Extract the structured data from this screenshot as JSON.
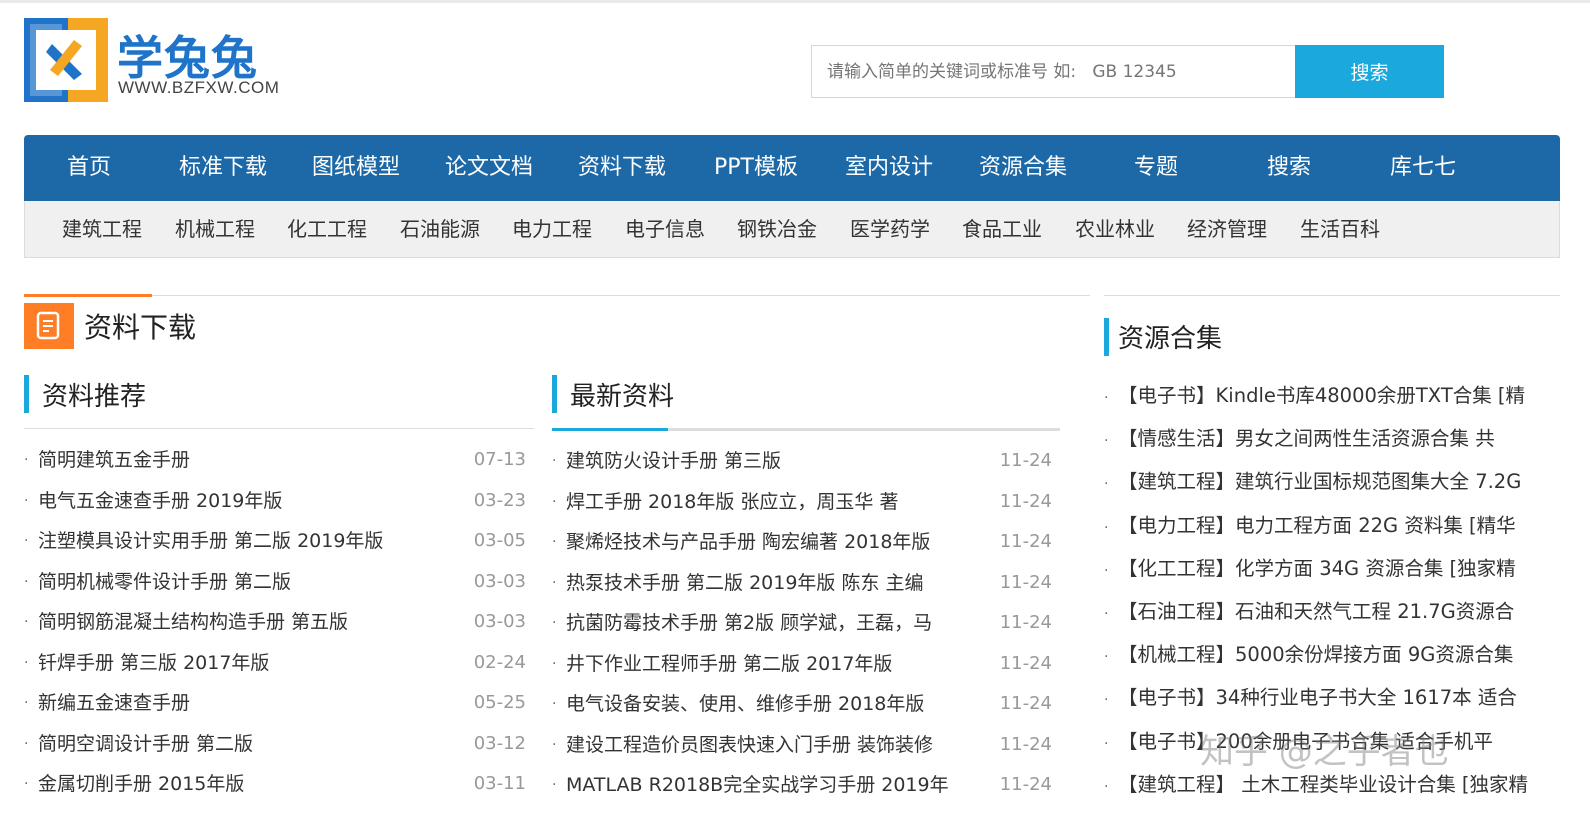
{
  "logo": {
    "brand_text": "学兔兔",
    "url_text": "WWW.BZFXW.COM",
    "colors": {
      "blue": "#1f74c9",
      "orange": "#f5a623"
    }
  },
  "search": {
    "placeholder": "请输入简单的关键词或标准号 如:   GB 12345",
    "button_label": "搜索",
    "button_color": "#1aa8dd"
  },
  "main_nav": {
    "color": "#1d69a8",
    "items": [
      "首页",
      "标准下载",
      "图纸模型",
      "论文文档",
      "资料下载",
      "PPT模板",
      "室内设计",
      "资源合集",
      "专题",
      "搜索",
      "库七七"
    ]
  },
  "sub_nav": {
    "items": [
      "建筑工程",
      "机械工程",
      "化工工程",
      "石油能源",
      "电力工程",
      "电子信息",
      "钢铁冶金",
      "医学药学",
      "食品工业",
      "农业林业",
      "经济管理",
      "生活百科"
    ]
  },
  "section": {
    "title": "资料下载",
    "accent": "#ff7d25",
    "icon": "document-icon"
  },
  "recommended": {
    "title": "资料推荐",
    "items": [
      {
        "title": "简明建筑五金手册",
        "date": "07-13"
      },
      {
        "title": "电气五金速查手册 2019年版",
        "date": "03-23"
      },
      {
        "title": "注塑模具设计实用手册 第二版 2019年版",
        "date": "03-05"
      },
      {
        "title": "简明机械零件设计手册 第二版",
        "date": "03-03"
      },
      {
        "title": "简明钢筋混凝土结构构造手册 第五版",
        "date": "03-03"
      },
      {
        "title": "钎焊手册 第三版 2017年版",
        "date": "02-24"
      },
      {
        "title": "新编五金速查手册",
        "date": "05-25"
      },
      {
        "title": "简明空调设计手册 第二版",
        "date": "03-12"
      },
      {
        "title": "金属切削手册 2015年版",
        "date": "03-11"
      }
    ]
  },
  "latest": {
    "title": "最新资料",
    "items": [
      {
        "title": "建筑防火设计手册 第三版",
        "date": "11-24"
      },
      {
        "title": "焊工手册 2018年版 张应立，周玉华 著",
        "date": "11-24"
      },
      {
        "title": "聚烯烃技术与产品手册 陶宏编著 2018年版",
        "date": "11-24"
      },
      {
        "title": "热泵技术手册 第二版 2019年版 陈东 主编",
        "date": "11-24"
      },
      {
        "title": "抗菌防霉技术手册 第2版 顾学斌，王磊，马",
        "date": "11-24"
      },
      {
        "title": "井下作业工程师手册 第二版 2017年版",
        "date": "11-24"
      },
      {
        "title": "电气设备安装、使用、维修手册 2018年版",
        "date": "11-24"
      },
      {
        "title": "建设工程造价员图表快速入门手册 装饰装修",
        "date": "11-24"
      },
      {
        "title": "MATLAB R2018B完全实战学习手册 2019年",
        "date": "11-24"
      }
    ]
  },
  "collections": {
    "title": "资源合集",
    "items": [
      "【电子书】Kindle书库48000余册TXT合集 [精",
      "【情感生活】男女之间两性生活资源合集 共",
      "【建筑工程】建筑行业国标规范图集大全 7.2G",
      "【电力工程】电力工程方面 22G 资料集 [精华",
      "【化工工程】化学方面 34G 资源合集 [独家精",
      "【石油工程】石油和天然气工程 21.7G资源合",
      "【机械工程】5000余份焊接方面 9G资源合集",
      "【电子书】34种行业电子书大全 1617本 适合",
      "【电子书】200余册电子书合集 适合手机平",
      "【建筑工程】 土木工程类毕业设计合集 [独家精"
    ]
  },
  "watermark": "知乎 @之乎者也"
}
